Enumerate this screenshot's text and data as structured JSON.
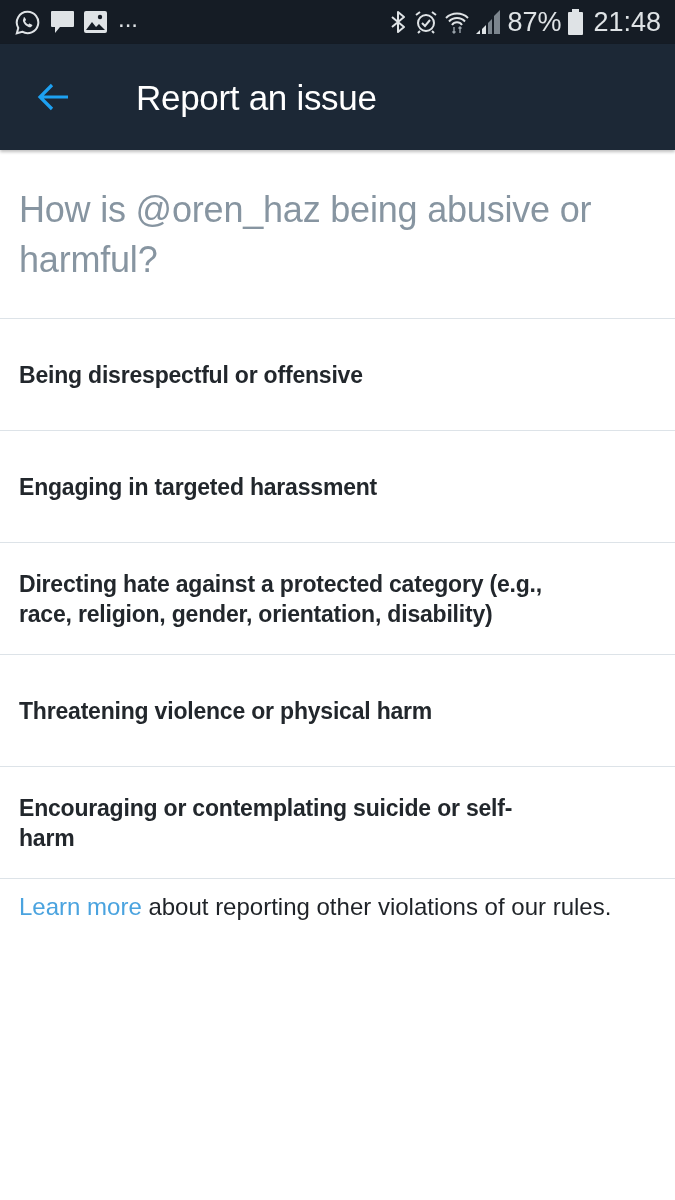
{
  "status_bar": {
    "more_notifications": "...",
    "battery_percent": "87%",
    "time": "21:48"
  },
  "app_bar": {
    "title": "Report an issue"
  },
  "question": "How is @oren_haz being abusive or harmful?",
  "options": [
    {
      "label": "Being disrespectful or offensive"
    },
    {
      "label": "Engaging in targeted harassment"
    },
    {
      "label": "Directing hate against a protected category (e.g., race, religion, gender, orientation, disability)"
    },
    {
      "label": "Threatening violence or physical harm"
    },
    {
      "label": "Encouraging or contemplating suicide or self-harm"
    }
  ],
  "footer": {
    "link": "Learn more",
    "text": "about reporting other violations of our rules."
  }
}
